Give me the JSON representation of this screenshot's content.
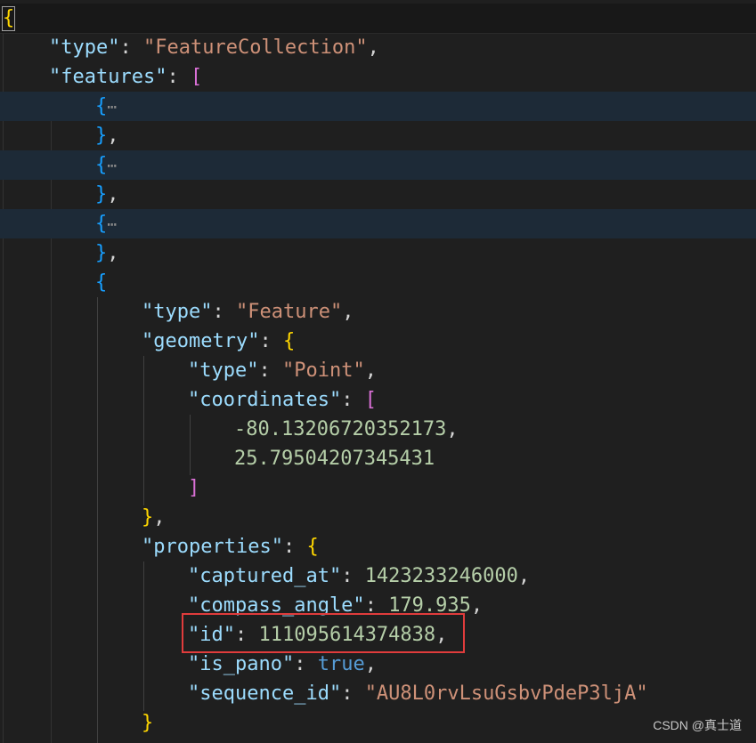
{
  "lines": {
    "l1_open": "{",
    "l2_key": "\"type\"",
    "l2_colon": ": ",
    "l2_val": "\"FeatureCollection\"",
    "l2_comma": ",",
    "l3_key": "\"features\"",
    "l3_colon": ": ",
    "l3_open": "[",
    "fold_open": "{",
    "fold_dots": "⋯",
    "fold_close": "}",
    "fold_comma": ",",
    "f4_open": "{",
    "f4_type_key": "\"type\"",
    "f4_type_val": "\"Feature\"",
    "geometry_key": "\"geometry\"",
    "geometry_open": "{",
    "geo_type_key": "\"type\"",
    "geo_type_val": "\"Point\"",
    "coords_key": "\"coordinates\"",
    "coords_open": "[",
    "coord_x": "-80.13206720352173",
    "coord_y": "25.79504207345431",
    "coords_close": "]",
    "geometry_close": "}",
    "properties_key": "\"properties\"",
    "properties_open": "{",
    "captured_at_key": "\"captured_at\"",
    "captured_at_val": "1423233246000",
    "compass_angle_key": "\"compass_angle\"",
    "compass_angle_val": "179.935",
    "id_key": "\"id\"",
    "id_val": "111095614374838",
    "is_pano_key": "\"is_pano\"",
    "is_pano_val": "true",
    "sequence_id_key": "\"sequence_id\"",
    "sequence_id_val": "\"AU8L0rvLsuGsbvPdeP3ljA\"",
    "properties_close": "}"
  },
  "punct": {
    "colon": ": ",
    "comma": ","
  },
  "watermark": "CSDN @真士道",
  "colors": {
    "background": "#1f1f1f",
    "key": "#9cdcfe",
    "string": "#ce9178",
    "number": "#b5cea8",
    "boolean": "#569cd6",
    "bracket_gold": "#ffd700",
    "bracket_magenta": "#da70d6",
    "bracket_blue": "#179fff",
    "highlight": "#e03c3c"
  }
}
